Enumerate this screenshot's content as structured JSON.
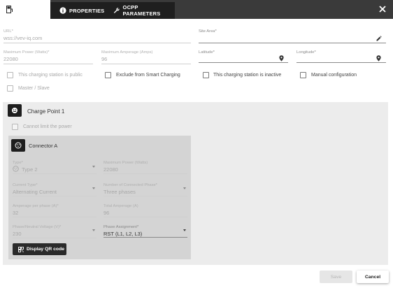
{
  "header": {
    "tabs": [
      {
        "label": "PROPERTIES",
        "icon": "info-icon"
      },
      {
        "label": "OCPP PARAMETERS",
        "icon": "wrench-icon"
      }
    ],
    "first_tab_icon": "charging-station-icon",
    "close_icon": "close-icon"
  },
  "station": {
    "url": {
      "label": "URL*",
      "value": "wss://vev-iq.com"
    },
    "site_area": {
      "label": "Site Area*",
      "value": ""
    },
    "max_power": {
      "label": "Maximum Power (Watts)*",
      "value": "22080"
    },
    "max_amperage": {
      "label": "Maximum Amperage (Amps)",
      "value": "96"
    },
    "latitude": {
      "label": "Latitude*",
      "value": ""
    },
    "longitude": {
      "label": "Longitude*",
      "value": ""
    },
    "checkboxes": {
      "public": "This charging station is public",
      "exclude_smart": "Exclude from Smart Charging",
      "inactive": "This charging station is inactive",
      "manual": "Manual configuration",
      "master_slave": "Master / Slave"
    }
  },
  "charge_point": {
    "title": "Charge Point 1",
    "cannot_limit": "Cannot limit the power",
    "connector": {
      "title": "Connector A",
      "type": {
        "label": "Type*",
        "value": "Type 2"
      },
      "max_power": {
        "label": "Maximum Power (Watts)",
        "value": "22080"
      },
      "current_type": {
        "label": "Current Type*",
        "value": "Alternating Current"
      },
      "phases": {
        "label": "Number of Connected Phase*",
        "value": "Three phases"
      },
      "amperage_per_phase": {
        "label": "Amperage per phase (A)*",
        "value": "32"
      },
      "total_amperage": {
        "label": "Total Amperage (A)",
        "value": "96"
      },
      "voltage": {
        "label": "Phase/Neutral Voltage (V)*",
        "value": "230"
      },
      "phase_assignment": {
        "label": "Phase Assignment*",
        "value": "RST (L1, L2, L3)"
      },
      "qr_button": "Display QR code"
    }
  },
  "footer": {
    "save": "Save",
    "cancel": "Cancel"
  },
  "colors": {
    "header_bg": "#3a3a3a",
    "tab_bg": "#1f1f1f",
    "panel_bg": "#ececec",
    "connector_bg": "#d4d4d4"
  }
}
